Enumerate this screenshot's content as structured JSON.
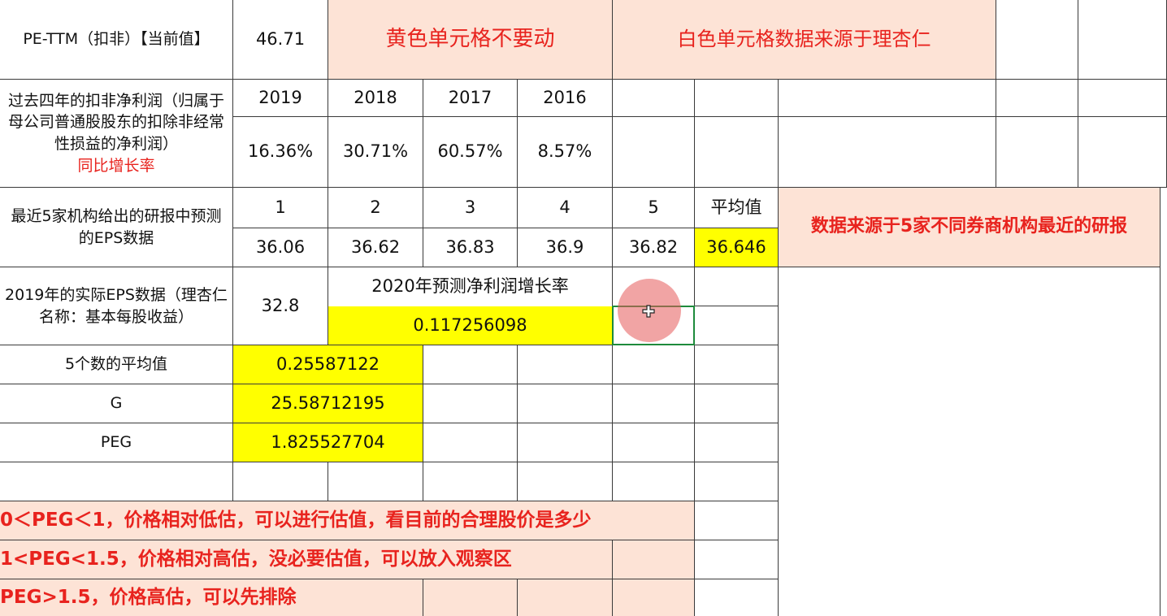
{
  "row1": {
    "label": "PE-TTM（扣非）【当前值】",
    "value": "46.71",
    "note_yellow": "黄色单元格不要动",
    "note_white": "白色单元格数据来源于理杏仁"
  },
  "profit_growth": {
    "label_main": "过去四年的扣非净利润（归属于母公司普通股股东的扣除非经常性损益的净利润）",
    "label_red": "同比增长率",
    "years": [
      "2019",
      "2018",
      "2017",
      "2016"
    ],
    "rates": [
      "16.36%",
      "30.71%",
      "60.57%",
      "8.57%"
    ]
  },
  "eps_forecast": {
    "label": "最近5家机构给出的研报中预测的EPS数据",
    "indices": [
      "1",
      "2",
      "3",
      "4",
      "5"
    ],
    "avg_header": "平均值",
    "values": [
      "36.06",
      "36.62",
      "36.83",
      "36.9",
      "36.82"
    ],
    "avg_value": "36.646",
    "source_note": "数据来源于5家不同券商机构最近的研报"
  },
  "actual_eps": {
    "label": "2019年的实际EPS数据（理杏仁名称：基本每股收益）",
    "value": "32.8",
    "growth_header": "2020年预测净利润增长率",
    "growth_value": "0.117256098"
  },
  "stats": {
    "avg_label": "5个数的平均值",
    "avg_value": "0.25587122",
    "g_label": "G",
    "g_value": "25.58712195",
    "peg_label": "PEG",
    "peg_value": "1.825527704"
  },
  "rules": {
    "rule1": "0＜PEG＜1，价格相对低估，可以进行估值，看目前的合理股价是多少",
    "rule2": "1<PEG<1.5，价格相对高估，没必要估值，可以放入观察区",
    "rule3": "PEG>1.5，价格高估，可以先排除"
  },
  "colors": {
    "yellow": "#ffff00",
    "peach": "#fde3d6",
    "red_text": "#e8231e",
    "selection": "#1e8b3c"
  },
  "icons": {
    "cursor": "cross-cursor-icon"
  }
}
